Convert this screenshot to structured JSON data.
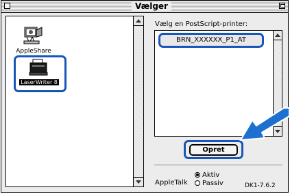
{
  "window": {
    "title": "Vælger"
  },
  "left_panel": {
    "items": [
      {
        "label": "AppleShare",
        "icon": "appleshare-icon",
        "selected": false
      },
      {
        "label": "LaserWriter 8",
        "icon": "laserwriter-icon",
        "selected": true
      }
    ]
  },
  "right_panel": {
    "label": "Vælg en PostScript-printer:",
    "printers": [
      {
        "name": "BRN_XXXXXX_P1_AT",
        "selected": true
      }
    ],
    "button_label": "Opret"
  },
  "appletalk": {
    "label": "AppleTalk",
    "options": [
      {
        "label": "Aktiv",
        "selected": true
      },
      {
        "label": "Passiv",
        "selected": false
      }
    ]
  },
  "version": "DK1-7.6.2",
  "colors": {
    "highlight": "#1656b8",
    "arrow": "#1d6fd0"
  }
}
